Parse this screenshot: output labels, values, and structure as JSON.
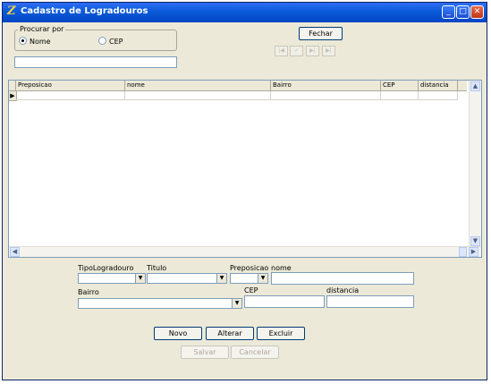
{
  "window": {
    "title": "Cadastro de Logradouros",
    "app_icon": "Z"
  },
  "titlebar_buttons": {
    "minimize": "_",
    "maximize": "□",
    "close": "✕"
  },
  "search": {
    "group_label": "Procurar por",
    "options": [
      {
        "label": "Nome",
        "selected": true
      },
      {
        "label": "CEP",
        "selected": false
      }
    ],
    "value": ""
  },
  "toolbar": {
    "close_label": "Fechar",
    "nav": [
      "|◀",
      "✓",
      "▶|",
      "▶|"
    ]
  },
  "grid": {
    "columns": [
      "Preposicao",
      "nome",
      "Bairro",
      "CEP",
      "distancia"
    ],
    "row_indicator": "▶"
  },
  "form": {
    "tipo_label": "TipoLogradouro",
    "titulo_label": "Titulo",
    "preposicao_label": "Preposicao",
    "nome_label": "nome",
    "bairro_label": "Bairro",
    "cep_label": "CEP",
    "distancia_label": "distancia"
  },
  "actions": {
    "novo": "Novo",
    "alterar": "Alterar",
    "excluir": "Excluir",
    "salvar": "Salvar",
    "cancelar": "Cancelar"
  }
}
